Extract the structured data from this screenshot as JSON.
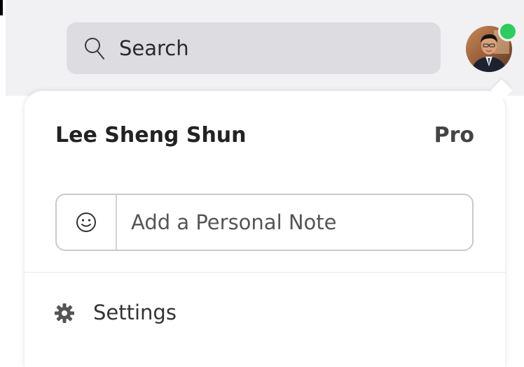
{
  "search": {
    "label": "Search",
    "icon": "search-icon"
  },
  "avatar": {
    "status": "online",
    "status_color": "#2ecc5e"
  },
  "profile": {
    "name": "Lee Sheng Shun",
    "plan": "Pro"
  },
  "note": {
    "placeholder": "Add a Personal Note",
    "icon": "smiley-icon"
  },
  "menu": {
    "settings_label": "Settings",
    "settings_icon": "gear-icon"
  }
}
